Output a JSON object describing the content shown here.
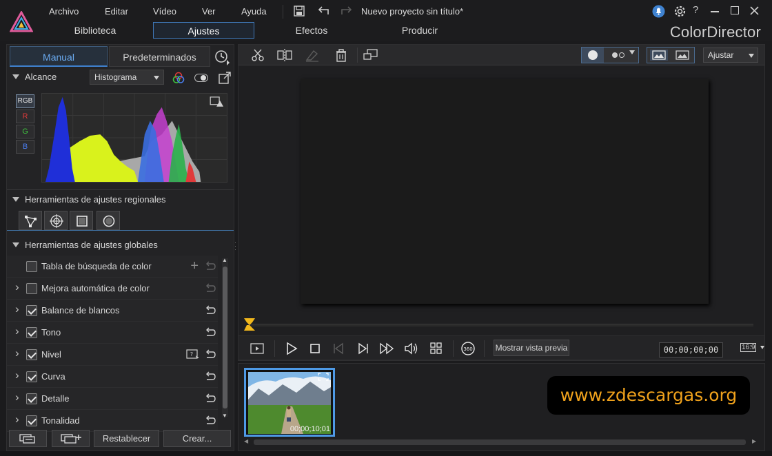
{
  "menu": [
    "Archivo",
    "Editar",
    "Vídeo",
    "Ver",
    "Ayuda"
  ],
  "project_title": "Nuevo proyecto sin título*",
  "main_tabs": [
    "Biblioteca",
    "Ajustes",
    "Efectos",
    "Producir"
  ],
  "active_tab": "Ajustes",
  "brand": "ColorDirector",
  "panel_tabs": {
    "manual": "Manual",
    "presets": "Predeterminados"
  },
  "scope": {
    "label": "Alcance",
    "select": "Histograma"
  },
  "channels": [
    "RGB",
    "R",
    "G",
    "B"
  ],
  "regional": {
    "label": "Herramientas de ajustes regionales"
  },
  "global": {
    "label": "Herramientas de ajustes globales",
    "items": [
      {
        "label": "Tabla de búsqueda de color",
        "checked": false,
        "expand": false
      },
      {
        "label": "Mejora automática de color",
        "checked": false,
        "expand": true
      },
      {
        "label": "Balance de blancos",
        "checked": true,
        "expand": true
      },
      {
        "label": "Tono",
        "checked": true,
        "expand": true
      },
      {
        "label": "Nivel",
        "checked": true,
        "expand": true
      },
      {
        "label": "Curva",
        "checked": true,
        "expand": true
      },
      {
        "label": "Detalle",
        "checked": true,
        "expand": true
      },
      {
        "label": "Tonalidad",
        "checked": true,
        "expand": true
      }
    ]
  },
  "bottom_buttons": {
    "reset": "Restablecer",
    "create": "Crear..."
  },
  "fit_select": "Ajustar",
  "preview_button": "Mostrar vista previa",
  "timecode": "00;00;00;00",
  "aspect": "16:9",
  "clip": {
    "duration": "00;00;10;01"
  },
  "watermark": "www.zdescargas.org",
  "colors": {
    "accent": "#3f82d0",
    "bg": "#1b1b1d",
    "watermark": "#f0a21c"
  }
}
